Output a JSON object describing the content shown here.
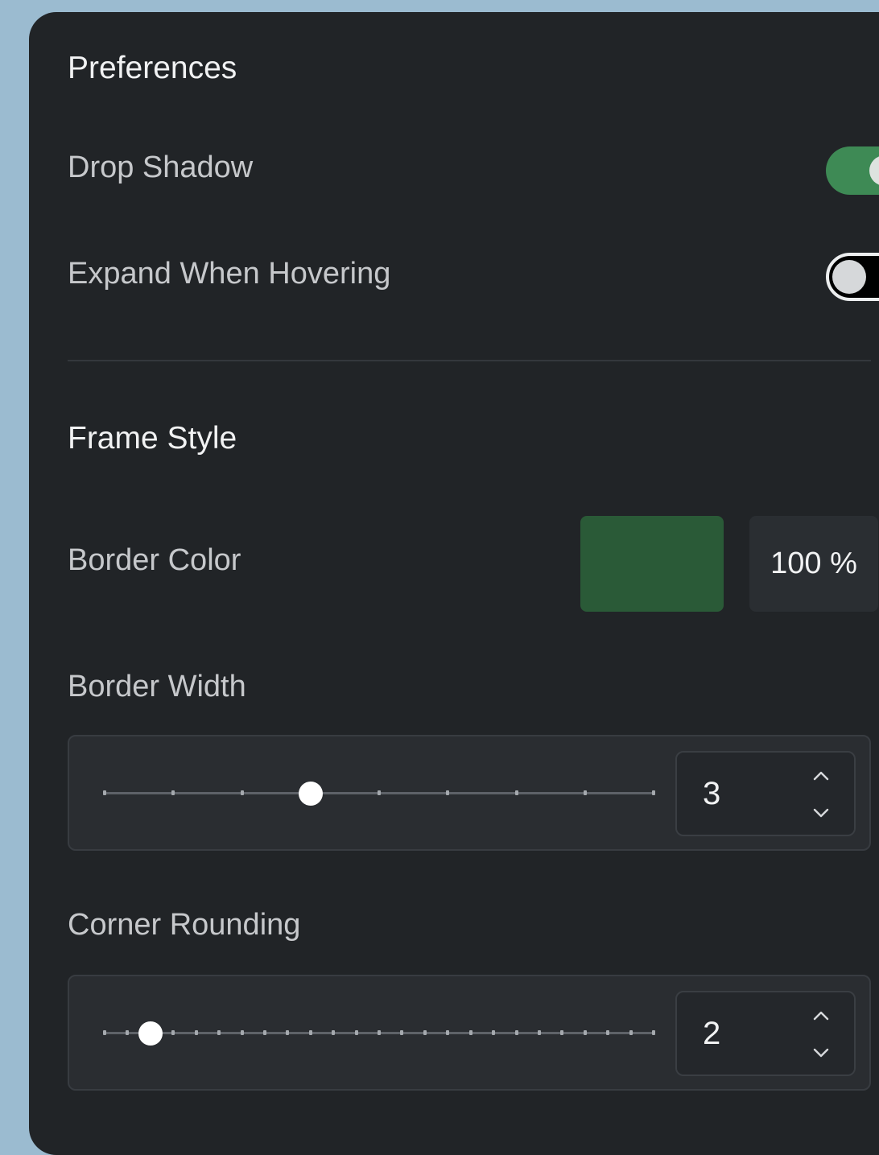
{
  "preferences": {
    "title": "Preferences",
    "drop_shadow": {
      "label": "Drop Shadow",
      "enabled": true
    },
    "expand_when_hovering": {
      "label": "Expand When Hovering",
      "enabled": false
    }
  },
  "frame_style": {
    "title": "Frame Style",
    "border_color": {
      "label": "Border Color",
      "color": "#2a5a37",
      "opacity": "100 %"
    },
    "border_width": {
      "label": "Border Width",
      "value": "3",
      "min": 0,
      "max": 8,
      "step": 1
    },
    "corner_rounding": {
      "label": "Corner Rounding",
      "value": "2",
      "min": 0,
      "max": 24,
      "step": 1
    }
  },
  "colors": {
    "panel": "#212427",
    "toggle_on": "#3e8a55",
    "background": "#9bbbd0"
  },
  "icons": {
    "increment": "chevron-up-icon",
    "decrement": "chevron-down-icon"
  }
}
